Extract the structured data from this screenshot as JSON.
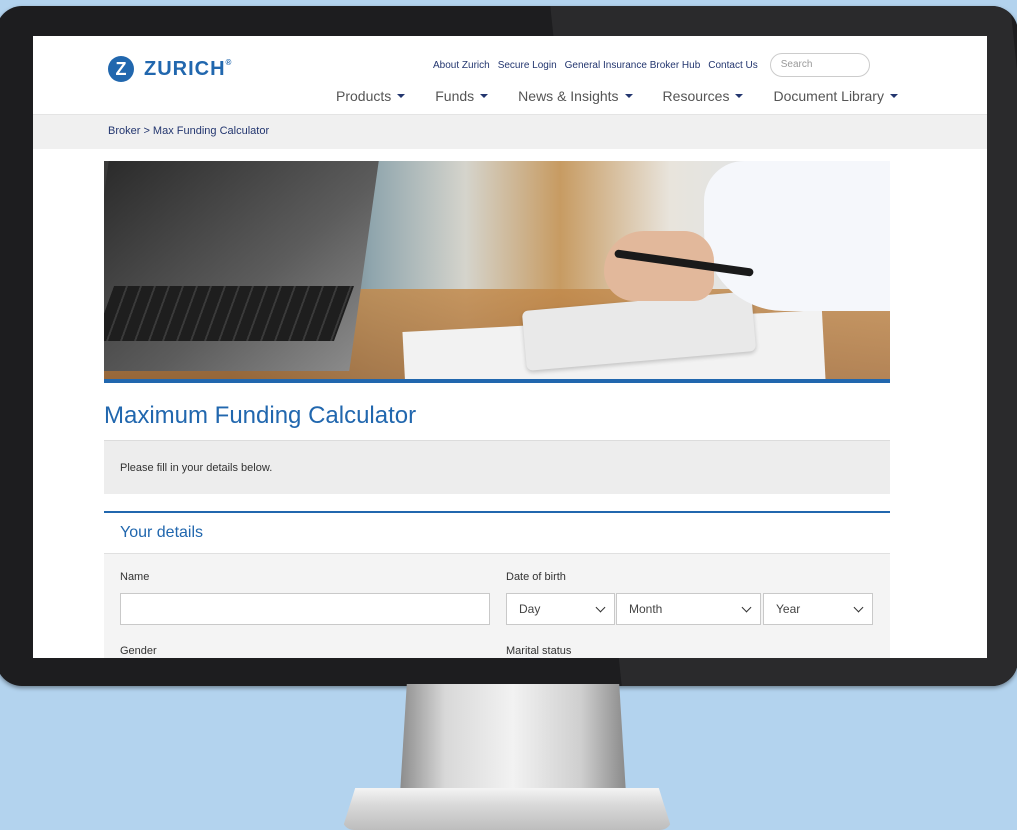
{
  "header": {
    "logo_mark": "Z",
    "logo_text": "ZURICH",
    "logo_reg": "®",
    "utility_links": [
      "About Zurich",
      "Secure Login",
      "General Insurance Broker Hub",
      "Contact Us"
    ],
    "search_placeholder": "Search",
    "main_nav": [
      "Products",
      "Funds",
      "News & Insights",
      "Resources",
      "Document Library"
    ]
  },
  "breadcrumb": "Broker  >  Max Funding Calculator",
  "page": {
    "title": "Maximum Funding Calculator",
    "intro": "Please fill in your details below."
  },
  "form": {
    "section_title": "Your details",
    "name_label": "Name",
    "name_value": "",
    "dob_label": "Date of birth",
    "dob_day": "Day",
    "dob_month": "Month",
    "dob_year": "Year",
    "gender_label": "Gender",
    "marital_label": "Marital status"
  },
  "colors": {
    "brand_blue": "#2167ae",
    "background": "#b3d3ee"
  }
}
